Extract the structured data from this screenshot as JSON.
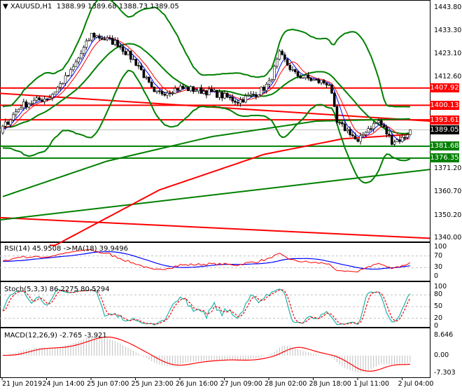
{
  "header": {
    "symbol": "XAUUSD,H1",
    "open": "1388.99",
    "high": "1389.68",
    "low": "1388.73",
    "close": "1389.05"
  },
  "price_axis": [
    "1443.80",
    "1433.30",
    "1423.10",
    "1412.60",
    "1371.20",
    "1360.70",
    "1350.20",
    "1340.00"
  ],
  "levels": [
    {
      "value": 1407.92,
      "label": "1407.92",
      "color": "#ff0000"
    },
    {
      "value": 1400.13,
      "label": "1400.13",
      "color": "#ff0000"
    },
    {
      "value": 1393.61,
      "label": "1393.61",
      "color": "#ff0000"
    },
    {
      "value": 1389.05,
      "label": "1389.05",
      "color": "#000000"
    },
    {
      "value": 1381.68,
      "label": "1381.68",
      "color": "#008000"
    },
    {
      "value": 1376.35,
      "label": "1376.35",
      "color": "#008000"
    }
  ],
  "time_axis": [
    "21 Jun 2019",
    "24 Jun 14:00",
    "25 Jun 07:00",
    "25 Jun 23:00",
    "26 Jun 16:00",
    "27 Jun 09:00",
    "28 Jun 02:00",
    "28 Jun 18:00",
    "1 Jul 11:00",
    "2 Jul 04:00"
  ],
  "rsi": {
    "label": "RSI(14) 45.9508  ->MA(18) 39.9496",
    "scale": [
      "100",
      "70",
      "30",
      "0"
    ]
  },
  "stoch": {
    "label": "Stoch(5,3,3) 86.2275 80.5294",
    "scale": [
      "100",
      "80",
      "50",
      "20",
      "0"
    ]
  },
  "macd": {
    "label": "MACD(12,26,9) -2.765 -3.921",
    "scale": [
      "8.646",
      "0.00",
      "-7.303"
    ]
  },
  "colors": {
    "bull": "#ffffff",
    "bear": "#000000",
    "bands": "#008000",
    "rsi": "#ff0000",
    "rsi_ma": "#0000ff",
    "stoch_main": "#20b2aa",
    "stoch_signal": "#ff0000",
    "macd_hist": "#c0c0c0",
    "macd_signal": "#ff0000"
  },
  "chart_data": {
    "type": "candlestick",
    "title": "XAUUSD,H1",
    "ylim": [
      1340.0,
      1443.8
    ],
    "bars": 157,
    "close_waypoints": [
      [
        0,
        1390
      ],
      [
        7,
        1400
      ],
      [
        18,
        1404
      ],
      [
        26,
        1415
      ],
      [
        34,
        1432
      ],
      [
        44,
        1428
      ],
      [
        52,
        1418
      ],
      [
        58,
        1405
      ],
      [
        68,
        1408
      ],
      [
        80,
        1406
      ],
      [
        90,
        1402
      ],
      [
        98,
        1406
      ],
      [
        102,
        1410
      ],
      [
        106,
        1423
      ],
      [
        112,
        1414
      ],
      [
        120,
        1411
      ],
      [
        125,
        1410
      ],
      [
        128,
        1392
      ],
      [
        133,
        1388
      ],
      [
        136,
        1383
      ],
      [
        139,
        1389
      ],
      [
        144,
        1393
      ],
      [
        149,
        1384
      ],
      [
        153,
        1385
      ],
      [
        156,
        1389.05
      ]
    ],
    "trendlines": [
      {
        "color": "#ff0000",
        "from": [
          0,
          1405.5
        ],
        "to": [
          156,
          1393.0
        ]
      },
      {
        "color": "#ff0000",
        "from": [
          0,
          1349.5
        ],
        "to": [
          156,
          1340.2
        ]
      },
      {
        "color": "#008000",
        "from": [
          0,
          1348.5
        ],
        "to": [
          156,
          1371.2
        ]
      }
    ],
    "ma200_waypoints": [
      [
        0,
        1359
      ],
      [
        40,
        1375
      ],
      [
        80,
        1386
      ],
      [
        120,
        1393
      ],
      [
        156,
        1394
      ]
    ],
    "ma100_waypoints": [
      [
        20,
        1337
      ],
      [
        60,
        1362
      ],
      [
        100,
        1378
      ],
      [
        130,
        1385
      ],
      [
        156,
        1387
      ]
    ]
  }
}
